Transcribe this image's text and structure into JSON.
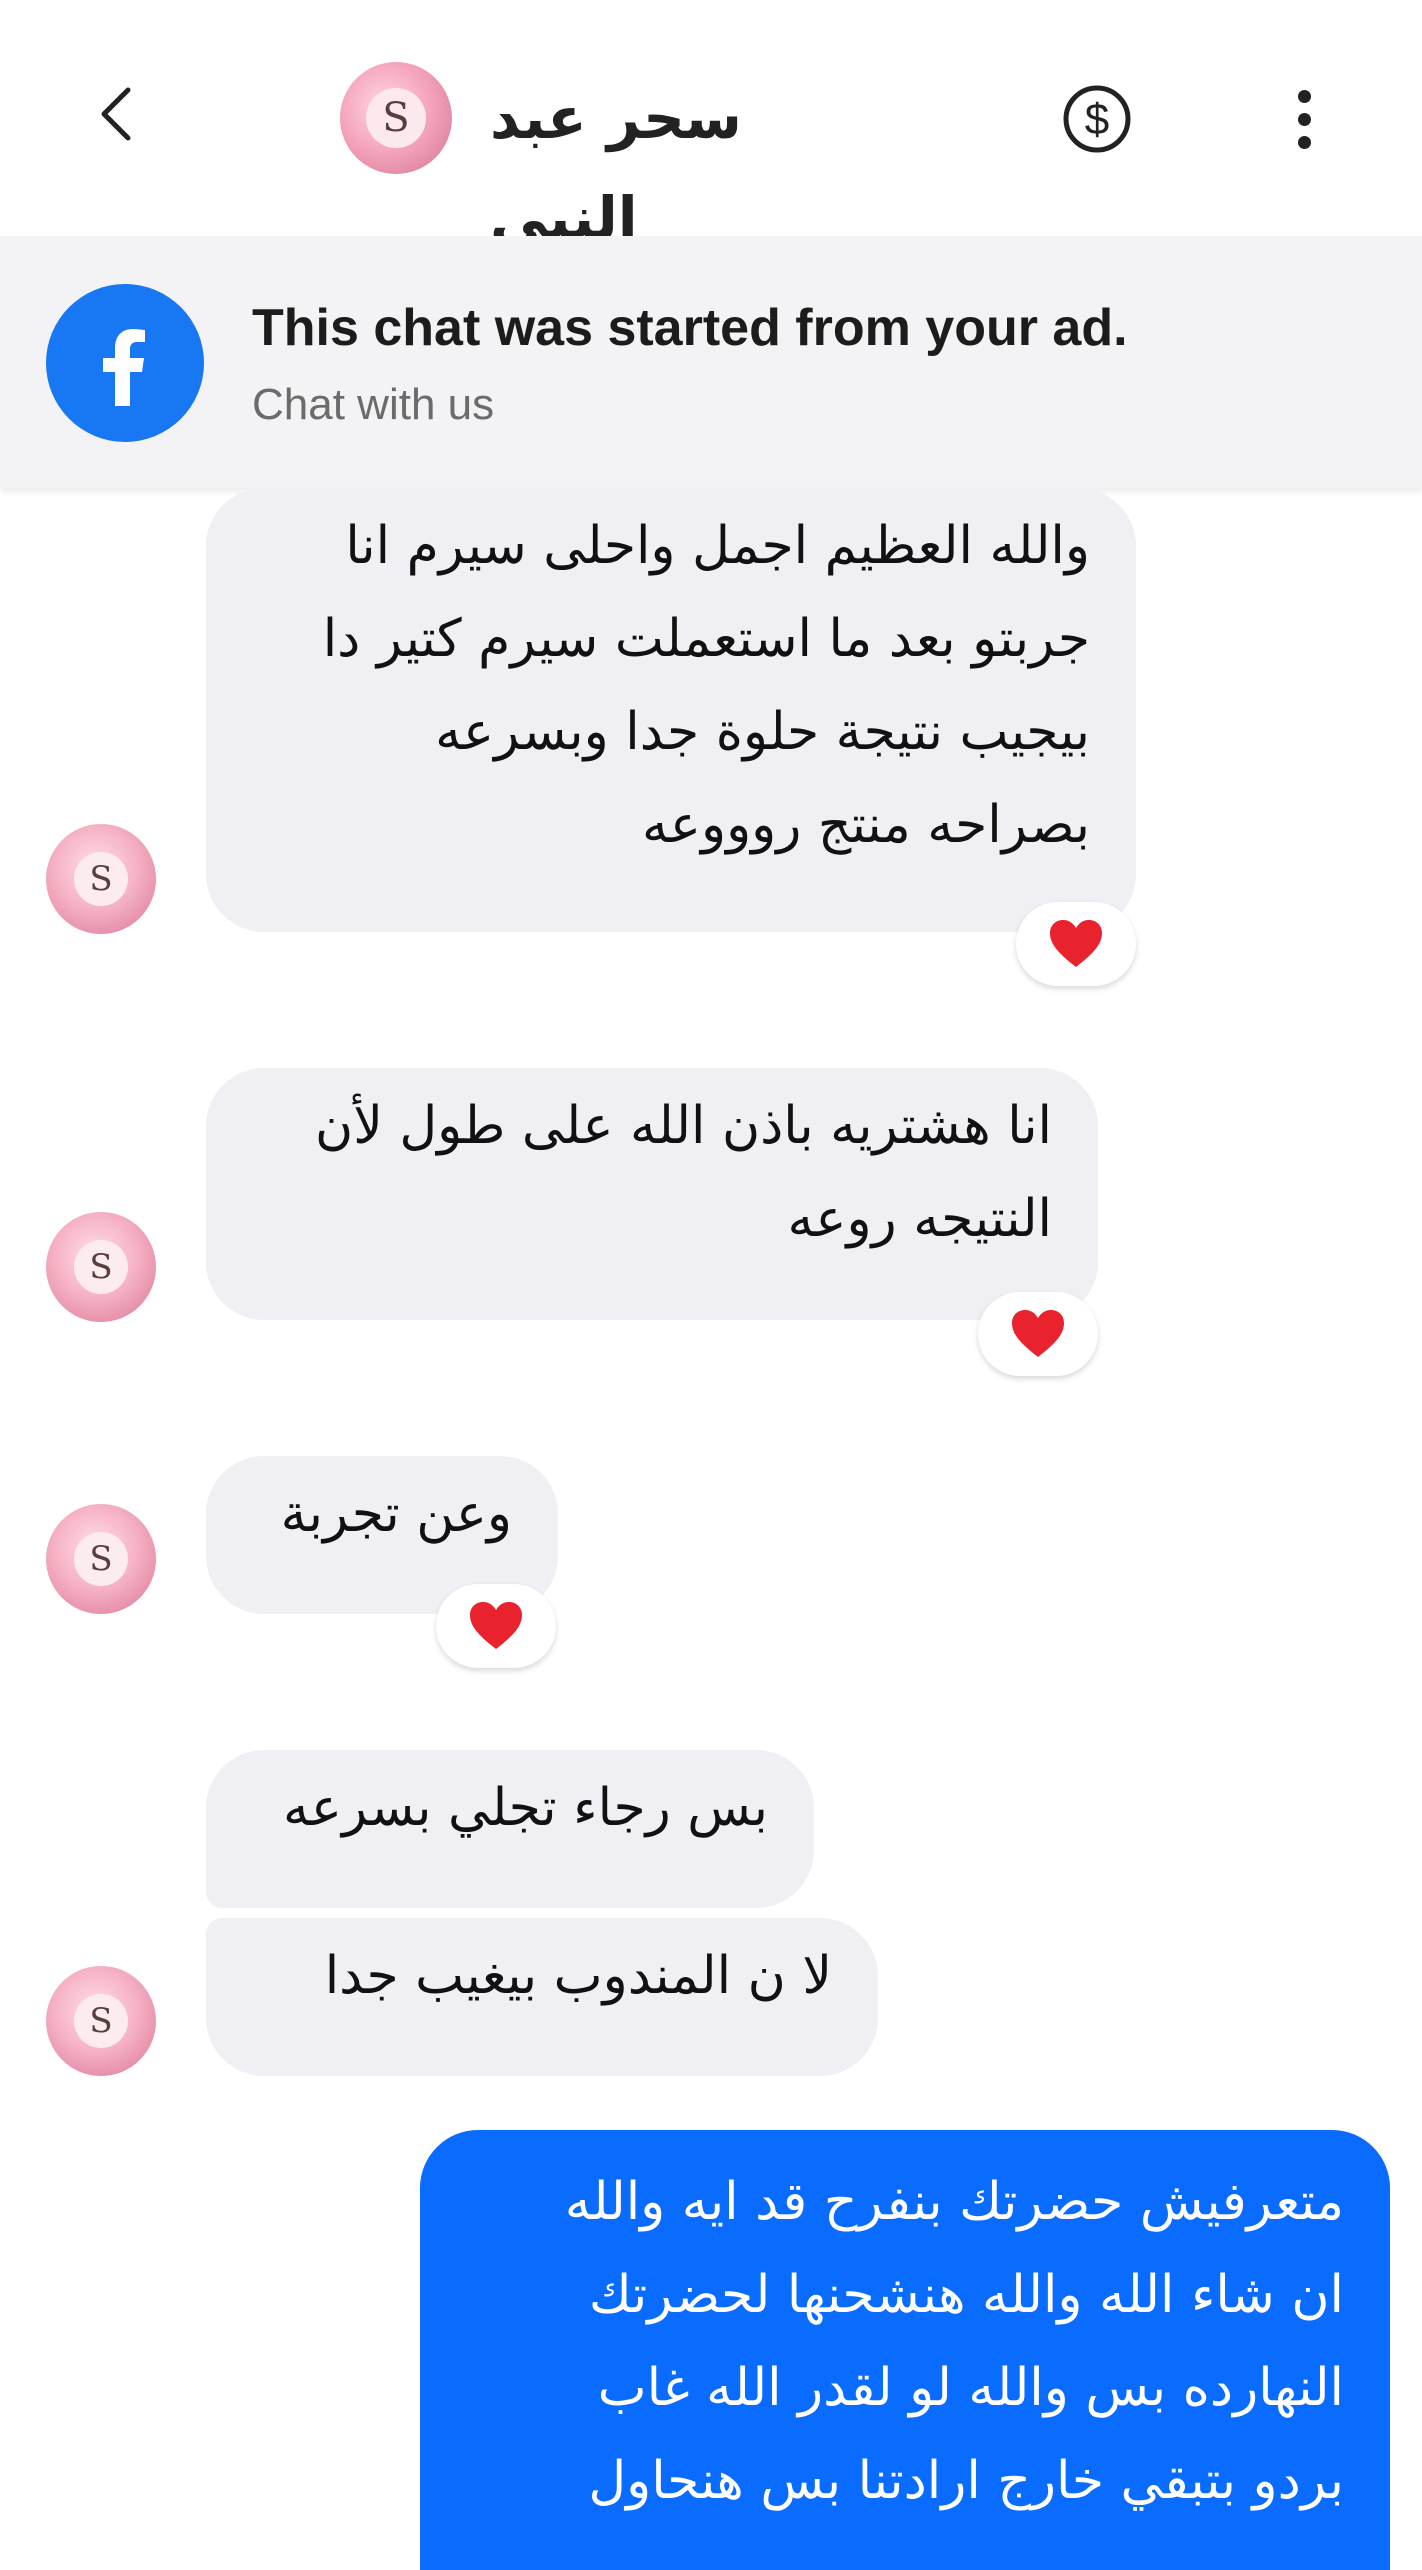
{
  "header": {
    "contact_name": "سحر عبد النبى",
    "avatar_letter": "S"
  },
  "ad_banner": {
    "title": "This chat was started from your ad.",
    "subtitle": "Chat with us"
  },
  "messages": [
    {
      "sender": "contact",
      "lines": [
        "والله العظيم اجمل واحلى سيرم انا",
        "جربتو بعد ما استعملت سيرم كتير دا",
        "بيجيب نتيجة حلوة جدا وبسرعه",
        "بصراحه منتج روووعه"
      ],
      "reaction": "heart"
    },
    {
      "sender": "contact",
      "lines": [
        "انا هشتريه باذن الله على طول لأن",
        "النتيجه روعه"
      ],
      "reaction": "heart"
    },
    {
      "sender": "contact",
      "lines": [
        "وعن تجربة"
      ],
      "reaction": "heart"
    },
    {
      "sender": "contact",
      "lines": [
        "بس رجاء تجلي بسرعه"
      ]
    },
    {
      "sender": "contact",
      "lines": [
        "لا ن المندوب بيغيب جدا"
      ]
    },
    {
      "sender": "me",
      "lines": [
        "متعرفيش حضرتك بنفرح قد ايه والله",
        "ان شاء الله والله هنشحنها لحضرتك",
        "النهارده بس والله لو لقدر الله غاب",
        "بردو بتبقي خارج ارادتنا بس هنحاول"
      ]
    }
  ],
  "colors": {
    "outgoing_bubble": "#0a6bff",
    "incoming_bubble": "#f0f0f4",
    "facebook_blue": "#1877f2",
    "heart": "#e8232d"
  },
  "icons": {
    "back": "chevron-left-icon",
    "payment": "dollar-circle-icon",
    "menu": "more-vertical-icon",
    "ad_source": "facebook-logo-icon",
    "reaction": "heart-icon"
  }
}
